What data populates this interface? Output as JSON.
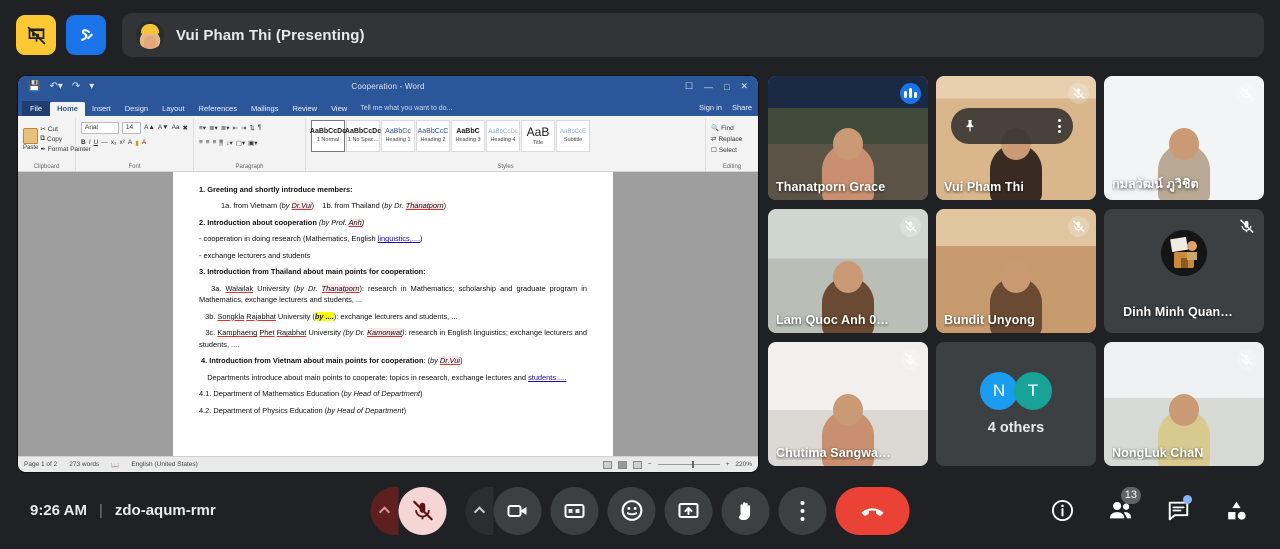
{
  "topbar": {
    "stop_presenting_icon": "presentation-off-icon",
    "whiteboard_icon": "jamboard-icon",
    "presenting_label": "Vui Pham Thi (Presenting)"
  },
  "shared_screen": {
    "app_title": "Cooperation - Word",
    "quick_access": [
      "save-icon",
      "undo-icon",
      "redo-icon",
      "customize-icon"
    ],
    "window_controls": [
      "ribbon-options-icon",
      "minimize-icon",
      "restore-icon",
      "close-icon"
    ],
    "tabs": [
      "File",
      "Home",
      "Insert",
      "Design",
      "Layout",
      "References",
      "Mailings",
      "Review",
      "View"
    ],
    "active_tab": "Home",
    "tell_me": "Tell me what you want to do...",
    "sign_in": "Sign in",
    "share": "Share",
    "ribbon": {
      "clipboard": {
        "label": "Clipboard",
        "paste": "Paste",
        "items": [
          "Cut",
          "Copy",
          "Format Painter"
        ]
      },
      "font": {
        "label": "Font",
        "family": "Arial",
        "size": "14",
        "buttons": [
          "A+",
          "A-",
          "Aa",
          "clear-format",
          "B",
          "I",
          "U",
          "strikethrough",
          "subscript",
          "superscript",
          "text-effects",
          "highlight",
          "font-color"
        ]
      },
      "paragraph": {
        "label": "Paragraph",
        "buttons": [
          "bullets",
          "numbering",
          "multilevel",
          "decrease-indent",
          "increase-indent",
          "sort",
          "show-marks",
          "align-left",
          "align-center",
          "align-right",
          "justify",
          "line-spacing",
          "shading",
          "borders"
        ]
      },
      "styles": {
        "label": "Styles",
        "items": [
          {
            "preview": "AaBbCcDc",
            "name": "1 Normal"
          },
          {
            "preview": "AaBbCcDc",
            "name": "1 No Spac..."
          },
          {
            "preview": "AaBbCc",
            "name": "Heading 1"
          },
          {
            "preview": "AaBbCcC",
            "name": "Heading 2"
          },
          {
            "preview": "AaBbC",
            "name": "Heading 3"
          },
          {
            "preview": "AaBbCcDc",
            "name": "Heading 4"
          },
          {
            "preview": "AaB",
            "name": "Title"
          },
          {
            "preview": "AaBbCcE",
            "name": "Subtitle"
          }
        ]
      },
      "editing": {
        "label": "Editing",
        "items": [
          "Find",
          "Replace",
          "Select"
        ]
      }
    },
    "document": {
      "lines": [
        {
          "text": "1. Greeting and shortly introduce members:",
          "style": "bold"
        },
        {
          "text": "1a. from Vietnam (by Dr.Vui)     1b. from Thailand (by Dr. Thanatporn)",
          "style": "indent"
        },
        {
          "text": "2. Introduction about cooperation (by Prof. Anh)",
          "style": "bold"
        },
        {
          "text": "- cooperation in doing research (Mathematics, English linguistics,....)",
          "style": "normal"
        },
        {
          "text": " - exchange lecturers and students",
          "style": "normal"
        },
        {
          "text": "3. Introduction from Thailand about main points for cooperation:",
          "style": "bold"
        },
        {
          "text": "3a. Walailak University (by Dr. Thanatporn): research in Mathematics; scholarship and graduate program in Mathematics, exchange lecturers and students, ...",
          "style": "para"
        },
        {
          "text": "3b. Songkla Rajabhat University (by ....): exchange lecturers and students, ...",
          "style": "para"
        },
        {
          "text": "3c. Kamphaeng Phet Rajabhat University (by Dr. Kamonwat): research in English linguistics; exchange lecturers and students, ....",
          "style": "para"
        },
        {
          "text": "4. Introduction from Vietnam about main points for cooperation: (by Dr.Vui)",
          "style": "bold"
        },
        {
          "text": "Departments introduce about main points to cooperate: topics in research, exchange lectures and students.....",
          "style": "para"
        },
        {
          "text": "4.1. Department of Mathematics Education (by Head of Department)",
          "style": "normal"
        },
        {
          "text": "4.2. Department of Physics Education (by Head of Department)",
          "style": "normal"
        }
      ]
    },
    "status_bar": {
      "page": "Page 1 of 2",
      "words": "273 words",
      "proofing_icon": "proofing-icon",
      "language": "English (United States)",
      "views": [
        "read-mode",
        "print-layout",
        "web-layout"
      ],
      "zoom": "220%"
    }
  },
  "participants": [
    {
      "name": "Thanatporn Grace",
      "state": "speaking",
      "camera": "on",
      "active": true,
      "bg": "bg-a",
      "person": "light"
    },
    {
      "name": "Vui Pham Thi",
      "state": "muted",
      "camera": "on",
      "active": false,
      "bg": "bg-b",
      "person": "dark",
      "hover": true
    },
    {
      "name": "กมลวัฒน์ ภูวิชิต",
      "state": "muted",
      "camera": "on",
      "active": false,
      "bg": "bg-c",
      "person": "suit"
    },
    {
      "name": "Lam Quoc Anh 0…",
      "state": "muted",
      "camera": "on",
      "active": false,
      "bg": "bg-d",
      "person": "mid"
    },
    {
      "name": "Bundit Unyong",
      "state": "muted",
      "camera": "on",
      "active": false,
      "bg": "bg-e",
      "person": "mid"
    },
    {
      "name": "Dinh Minh Quan…",
      "state": "muted",
      "camera": "off",
      "active": false,
      "bg": "",
      "person": ""
    },
    {
      "name": "Chutima Sangwa…",
      "state": "muted",
      "camera": "on",
      "active": false,
      "bg": "bg-f",
      "person": "light"
    },
    {
      "name": "NongLuk ChaN",
      "state": "muted",
      "camera": "on",
      "active": false,
      "bg": "bg-g",
      "person": "flor"
    }
  ],
  "others_tile": {
    "label": "4 others",
    "avatars": [
      {
        "letter": "N",
        "color": "#1a9cf0"
      },
      {
        "letter": "T",
        "color": "#17a398"
      }
    ]
  },
  "hover_overlay": {
    "pin_icon": "pin-icon",
    "more_icon": "more-vert-icon"
  },
  "bottom": {
    "time": "9:26 AM",
    "separator": "|",
    "meeting_code": "zdo-aqum-rmr",
    "controls": [
      {
        "name": "mic-options-chevron",
        "icon": "chevron-up-icon"
      },
      {
        "name": "microphone-button",
        "icon": "mic-off-icon",
        "state": "muted"
      },
      {
        "name": "camera-options-chevron",
        "icon": "chevron-up-icon"
      },
      {
        "name": "camera-button",
        "icon": "video-camera-icon",
        "state": "on"
      },
      {
        "name": "captions-button",
        "icon": "closed-captions-icon"
      },
      {
        "name": "reactions-button",
        "icon": "emoji-smile-icon"
      },
      {
        "name": "present-button",
        "icon": "present-screen-icon"
      },
      {
        "name": "raise-hand-button",
        "icon": "raised-hand-icon"
      },
      {
        "name": "more-options-button",
        "icon": "more-vert-icon"
      },
      {
        "name": "leave-call-button",
        "icon": "end-call-icon"
      }
    ],
    "right_controls": [
      {
        "name": "meeting-details-button",
        "icon": "info-icon",
        "badge": ""
      },
      {
        "name": "people-button",
        "icon": "people-icon",
        "badge": "13"
      },
      {
        "name": "chat-button",
        "icon": "chat-icon",
        "badge": "",
        "dot": true
      },
      {
        "name": "activities-button",
        "icon": "activities-icon",
        "badge": ""
      }
    ]
  },
  "colors": {
    "bg": "#202124",
    "tile": "#3c4043",
    "accent_blue": "#8ab4f8",
    "end_red": "#ea4335",
    "muted_pink": "#f6d5d5",
    "yellow": "#fcc934",
    "blue": "#1a73e8",
    "word_blue": "#2b579a"
  }
}
